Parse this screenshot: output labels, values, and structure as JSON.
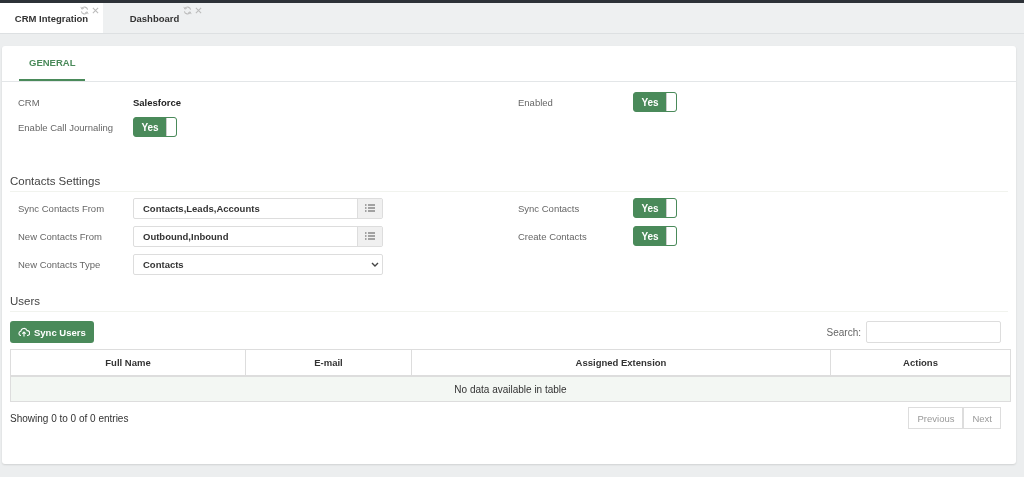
{
  "page_tabs": [
    {
      "label": "CRM Integration",
      "selected": true
    },
    {
      "label": "Dashboard",
      "selected": false
    }
  ],
  "section_tabs": [
    {
      "label": "GENERAL",
      "selected": true
    }
  ],
  "general": {
    "left": [
      {
        "kind": "text",
        "label": "CRM",
        "value": "Salesforce"
      },
      {
        "kind": "toggle",
        "label": "Enable Call Journaling",
        "on": true,
        "text": "Yes"
      }
    ],
    "right": [
      {
        "kind": "toggle",
        "label": "Enabled",
        "on": true,
        "text": "Yes"
      }
    ]
  },
  "contacts_settings": {
    "title": "Contacts Settings",
    "left": [
      {
        "kind": "multiselect",
        "label": "Sync Contacts From",
        "value": "Contacts,Leads,Accounts"
      },
      {
        "kind": "multiselect",
        "label": "New Contacts From",
        "value": "Outbound,Inbound"
      },
      {
        "kind": "select",
        "label": "New Contacts Type",
        "value": "Contacts"
      }
    ],
    "right": [
      {
        "kind": "toggle",
        "label": "Sync Contacts",
        "on": true,
        "text": "Yes"
      },
      {
        "kind": "toggle",
        "label": "Create Contacts",
        "on": true,
        "text": "Yes"
      }
    ]
  },
  "users": {
    "title": "Users",
    "sync_button": "Sync Users",
    "search_label": "Search:",
    "table": {
      "columns": [
        "Full Name",
        "E-mail",
        "Assigned Extension",
        "Actions"
      ],
      "empty_message": "No data available in table"
    },
    "info": "Showing 0 to 0 of 0 entries",
    "pagination": [
      {
        "label": "Previous",
        "disabled": true
      },
      {
        "label": "Next",
        "disabled": true
      }
    ]
  }
}
